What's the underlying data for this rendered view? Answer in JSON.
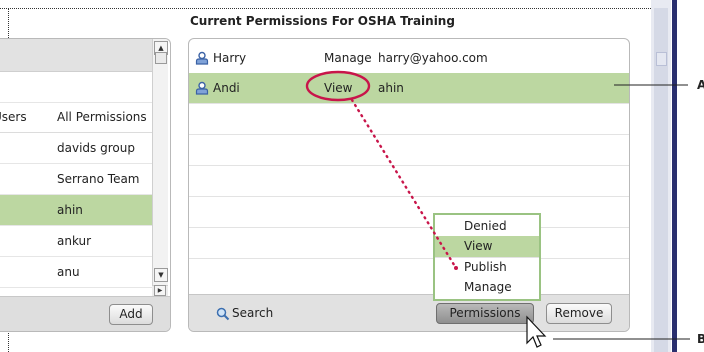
{
  "left_panel": {
    "columns": [
      "Users",
      "All Permissions"
    ],
    "rows": [
      {
        "col2": "davids group"
      },
      {
        "col2": "Serrano Team"
      },
      {
        "col2": "ahin",
        "selected": true
      },
      {
        "col2": "ankur"
      },
      {
        "col2": "anu"
      }
    ],
    "add_label": "Add"
  },
  "right_panel": {
    "title": "Current Permissions For OSHA Training",
    "rows": [
      {
        "name": "Harry",
        "permission": "Manage",
        "email": "harry@yahoo.com"
      },
      {
        "name": "Andi",
        "permission": "View",
        "email": "ahin",
        "selected": true
      }
    ],
    "search_label": "Search",
    "permissions_label": "Permissions",
    "remove_label": "Remove"
  },
  "permission_menu": {
    "options": [
      "Denied",
      "View",
      "Publish",
      "Manage"
    ],
    "selected": "View"
  },
  "callouts": {
    "a": "A",
    "b": "B"
  },
  "colors": {
    "selection": "#bcd7a1",
    "highlight": "#c8154a",
    "accent": "#2a2f6e"
  }
}
